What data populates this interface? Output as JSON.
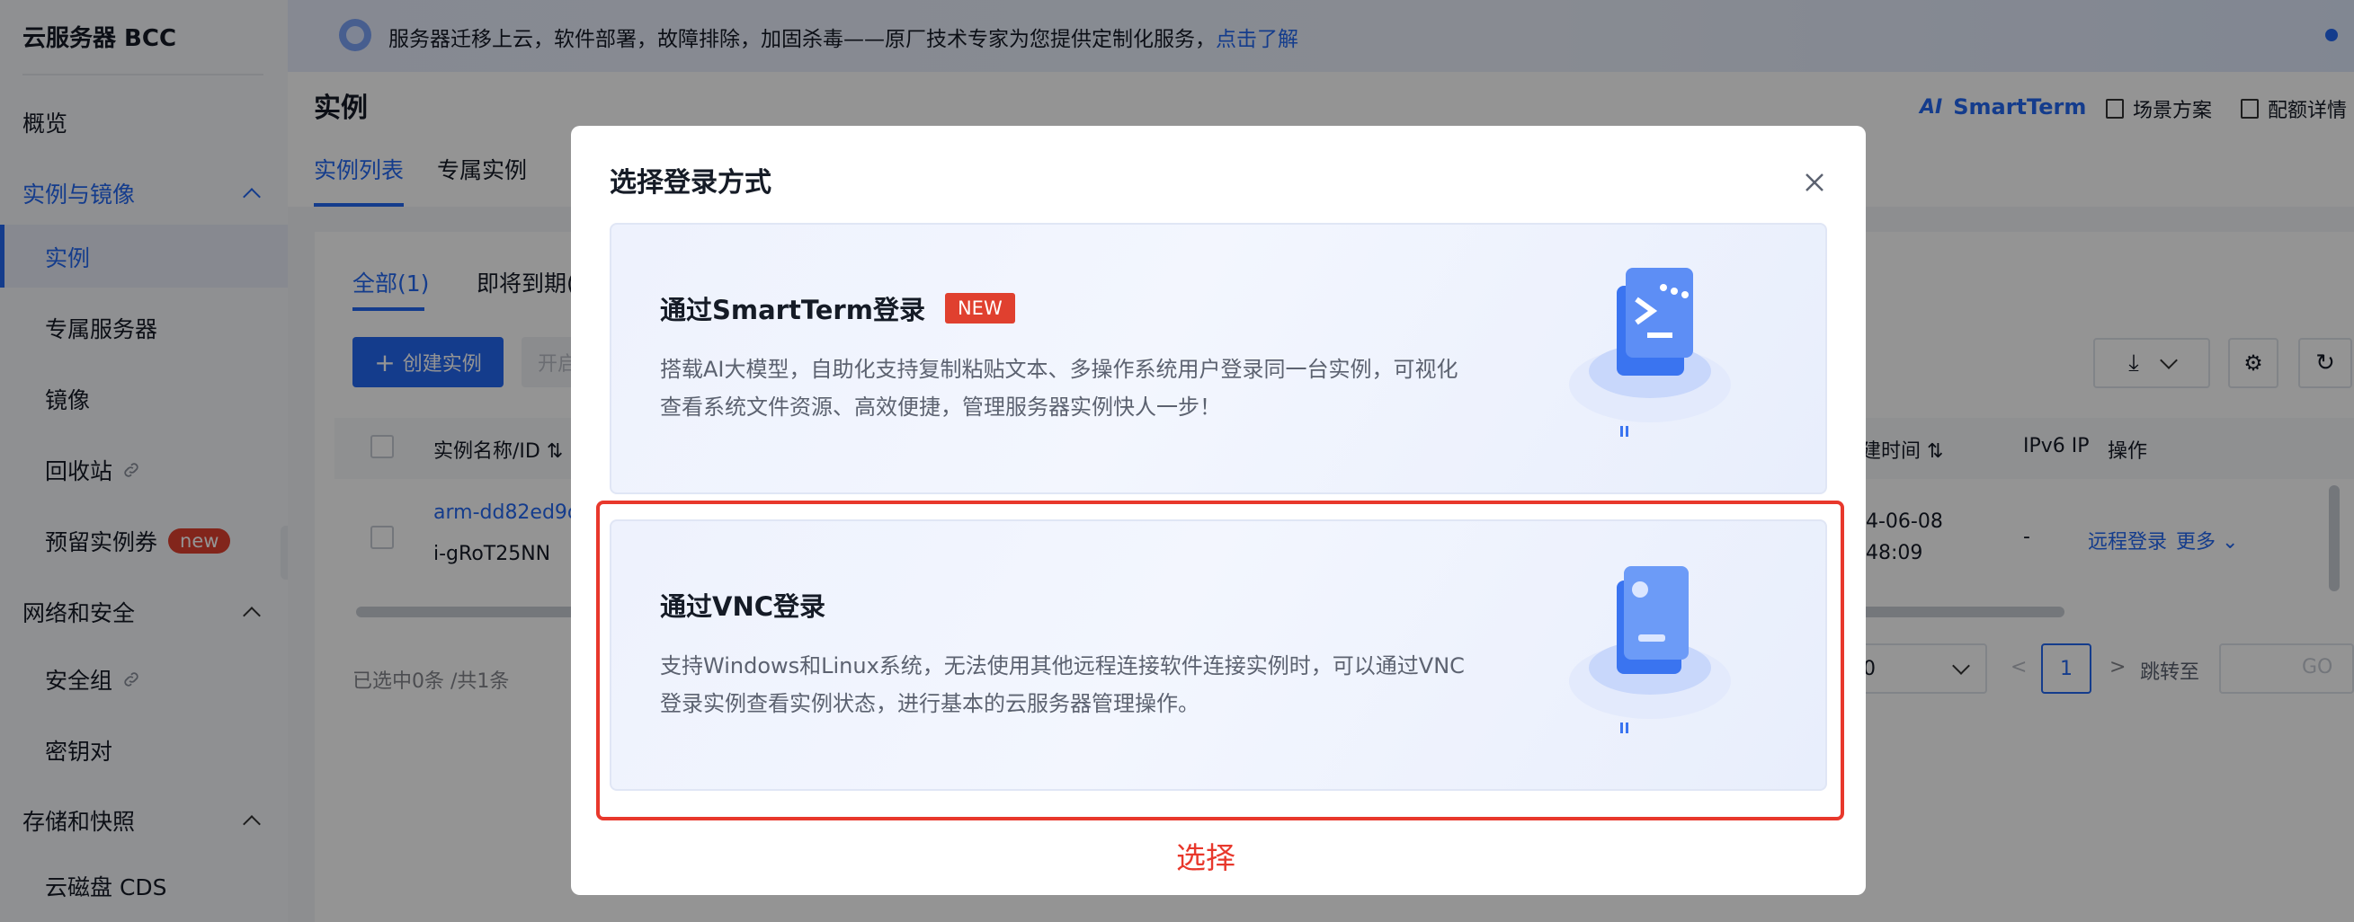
{
  "sidebar": {
    "title": "云服务器 BCC",
    "items": [
      {
        "label": "概览"
      },
      {
        "label": "实例与镜像"
      },
      {
        "label": "实例"
      },
      {
        "label": "专属服务器"
      },
      {
        "label": "镜像"
      },
      {
        "label": "回收站"
      },
      {
        "label": "预留实例券",
        "badge": "new"
      },
      {
        "label": "网络和安全"
      },
      {
        "label": "安全组"
      },
      {
        "label": "密钥对"
      },
      {
        "label": "存储和快照"
      },
      {
        "label": "云磁盘 CDS"
      }
    ]
  },
  "banner": {
    "text": "服务器迁移上云，软件部署，故障排除，加固杀毒——原厂技术专家为您提供定制化服务，",
    "link": "点击了解"
  },
  "page": {
    "title": "实例",
    "tabs": [
      "实例列表",
      "专属实例"
    ],
    "header_right": {
      "smartterm": "SmartTerm",
      "scenario": "场景方案",
      "config": "配额详情"
    },
    "subtabs": [
      "全部(1)",
      "即将到期("
    ],
    "create_button": "创建实例",
    "start_button": "开启",
    "table": {
      "col_name": "实例名称/ID",
      "col_time": "建时间",
      "col_ipv6": "IPv6 IP",
      "col_ops": "操作",
      "row": {
        "name": "arm-dd82ed9d",
        "id": "i-gRoT25NN",
        "time_line1": "4-06-08",
        "time_line2": "48:09",
        "ipv6": "-",
        "remote_login": "远程登录",
        "more": "更多"
      }
    },
    "footer": {
      "selected": "已选中0条 /共1条",
      "page_size": "0",
      "prev": "<",
      "current_page": "1",
      "next": ">",
      "jump_to": "跳转至",
      "go": "GO"
    }
  },
  "modal": {
    "title": "选择登录方式",
    "options": [
      {
        "title": "通过SmartTerm登录",
        "tag": "NEW",
        "desc_line1": "搭载AI大模型，自助化支持复制粘贴文本、多操作系统用户登录同一台实例，可视化",
        "desc_line2": "查看系统文件资源、高效便捷，管理服务器实例快人一步！"
      },
      {
        "title": "通过VNC登录",
        "desc_line1": "支持Windows和Linux系统，无法使用其他远程连接软件连接实例时，可以通过VNC",
        "desc_line2": "登录实例查看实例状态，进行基本的云服务器管理操作。"
      }
    ]
  },
  "annotation": {
    "label": "选择"
  },
  "colors": {
    "accent": "#2468f2",
    "highlight": "#e8382c",
    "badge": "#e0402f"
  }
}
